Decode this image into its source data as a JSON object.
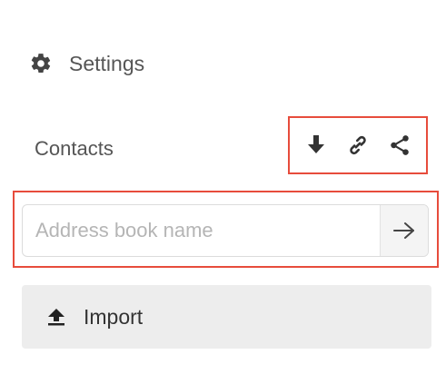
{
  "settings": {
    "label": "Settings",
    "icon": "gear-icon"
  },
  "contacts": {
    "label": "Contacts",
    "actions": [
      {
        "name": "download-icon"
      },
      {
        "name": "link-icon"
      },
      {
        "name": "share-icon"
      }
    ]
  },
  "address_book": {
    "placeholder": "Address book name",
    "value": "",
    "submit_icon": "arrow-right-icon"
  },
  "import": {
    "label": "Import",
    "icon": "upload-icon"
  },
  "colors": {
    "highlight": "#e74c3c",
    "text": "#555555",
    "button_bg": "#ededed"
  }
}
